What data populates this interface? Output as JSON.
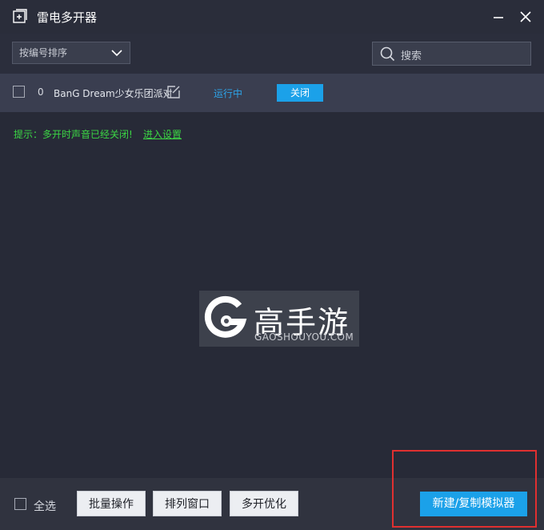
{
  "window": {
    "title": "雷电多开器",
    "title_icon": "add-window-icon",
    "minimize_icon": "minimize-icon",
    "close_icon": "close-icon"
  },
  "toolbar": {
    "sort_value": "按编号排序",
    "sort_icon": "chevron-down-icon",
    "search_placeholder": "搜索",
    "search_icon": "search-icon"
  },
  "instances": [
    {
      "index": "0",
      "name": "BanG Dream少女乐团派对",
      "edit_icon": "edit-icon",
      "status": "运行中",
      "action_label": "关闭"
    }
  ],
  "tip": {
    "text": "提示：多开时声音已经关闭!",
    "link": "进入设置"
  },
  "watermark": {
    "text": "高手游",
    "subtext": "GAOSHOUYOU.COM"
  },
  "footer": {
    "select_all_label": "全选",
    "batch_label": "批量操作",
    "arrange_label": "排列窗口",
    "optimize_label": "多开优化",
    "new_label": "新建/复制模拟器"
  },
  "colors": {
    "background": "#272a37",
    "row": "#3a3e50",
    "accent": "#1ba1e9",
    "tip_green": "#3bd644",
    "highlight": "#e03030"
  }
}
